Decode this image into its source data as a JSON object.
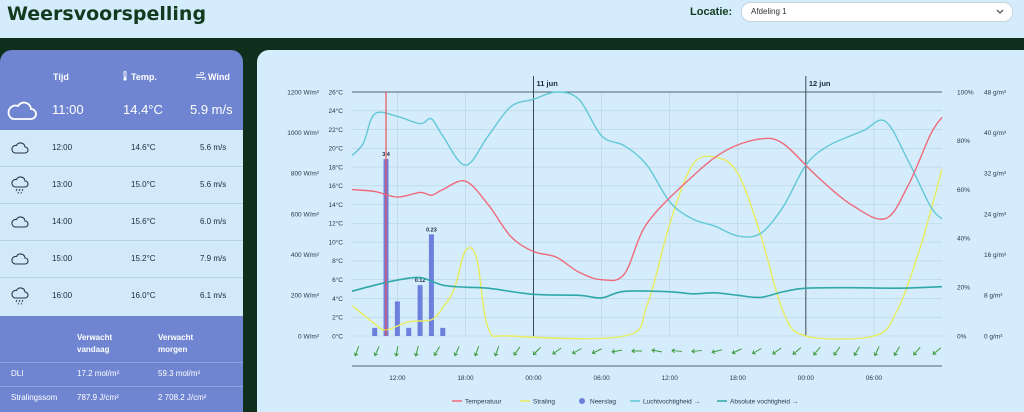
{
  "header": {
    "title": "Weersvoorspelling",
    "location_label": "Locatie:",
    "location_value": "Afdeling 1"
  },
  "current": {
    "col_time": "Tijd",
    "col_temp": "Temp.",
    "col_wind": "Wind",
    "time": "11:00",
    "temp": "14.4°C",
    "wind": "5.9 m/s",
    "icon": "cloud-icon"
  },
  "forecast": [
    {
      "time": "12:00",
      "temp": "14.6°C",
      "wind": "5.6 m/s",
      "icon": "cloud-icon"
    },
    {
      "time": "13:00",
      "temp": "15.0°C",
      "wind": "5.6 m/s",
      "icon": "cloud-drizzle-icon"
    },
    {
      "time": "14:00",
      "temp": "15.6°C",
      "wind": "6.0 m/s",
      "icon": "cloud-icon"
    },
    {
      "time": "15:00",
      "temp": "15.2°C",
      "wind": "7.9 m/s",
      "icon": "cloud-icon"
    },
    {
      "time": "16:00",
      "temp": "16.0°C",
      "wind": "6.1 m/s",
      "icon": "cloud-drizzle-icon"
    }
  ],
  "summary": {
    "col_today": "Verwacht vandaag",
    "col_tomorrow": "Verwacht morgen",
    "rows": [
      {
        "label": "DLI",
        "today": "17.2 mol/m²",
        "tomorrow": "59.3 mol/m²"
      },
      {
        "label": "Stralingssom",
        "today": "787.9 J/cm²",
        "tomorrow": "2 708.2 J/cm²"
      }
    ]
  },
  "chart_data": {
    "type": "line",
    "day_labels": [
      "11 jun",
      "12 jun"
    ],
    "x_ticks": [
      "12:00",
      "18:00",
      "00:00",
      "06:00",
      "12:00",
      "18:00",
      "00:00",
      "06:00"
    ],
    "axes": {
      "radiation": {
        "ticks": [
          "0 W/m²",
          "200 W/m²",
          "400 W/m²",
          "600 W/m²",
          "800 W/m²",
          "1000 W/m²",
          "1200 W/m²"
        ],
        "range": [
          0,
          1200
        ]
      },
      "temperature": {
        "ticks": [
          "0°C",
          "2°C",
          "4°C",
          "6°C",
          "8°C",
          "10°C",
          "12°C",
          "14°C",
          "16°C",
          "18°C",
          "20°C",
          "22°C",
          "24°C",
          "26°C"
        ],
        "range": [
          0,
          26
        ]
      },
      "humidity": {
        "ticks": [
          "0%",
          "20%",
          "40%",
          "60%",
          "80%",
          "100%"
        ],
        "range": [
          0,
          100
        ]
      },
      "absolute_humidity": {
        "ticks": [
          "0 g/m³",
          "8 g/m³",
          "16 g/m³",
          "24 g/m³",
          "32 g/m³",
          "40 g/m³",
          "48 g/m³"
        ],
        "range": [
          0,
          48
        ]
      }
    },
    "x_range_hours": [
      0,
      52
    ],
    "current_hour": 3,
    "series": [
      {
        "name": "Temperatuur",
        "color": "#ef6a7a",
        "axis": "temperature",
        "points": [
          [
            0,
            15.6
          ],
          [
            2,
            15.4
          ],
          [
            4,
            14.8
          ],
          [
            6,
            15.3
          ],
          [
            7,
            15.0
          ],
          [
            8,
            15.6
          ],
          [
            10,
            16.5
          ],
          [
            12,
            14.0
          ],
          [
            14,
            10.6
          ],
          [
            16,
            9.0
          ],
          [
            18,
            8.4
          ],
          [
            20,
            6.8
          ],
          [
            22,
            6.0
          ],
          [
            24,
            6.6
          ],
          [
            26,
            12.0
          ],
          [
            30,
            17.0
          ],
          [
            33,
            19.8
          ],
          [
            36,
            21.0
          ],
          [
            38,
            20.5
          ],
          [
            41,
            17.0
          ],
          [
            44,
            14.0
          ],
          [
            47,
            12.5
          ],
          [
            49,
            16.0
          ],
          [
            51,
            21.5
          ],
          [
            52,
            23.3
          ]
        ]
      },
      {
        "name": "Straling",
        "color": "#e9ec5d",
        "axis": "radiation",
        "points": [
          [
            0,
            150
          ],
          [
            2,
            60
          ],
          [
            3,
            30
          ],
          [
            5,
            70
          ],
          [
            7,
            80
          ],
          [
            8,
            140
          ],
          [
            9,
            230
          ],
          [
            10,
            420
          ],
          [
            11,
            380
          ],
          [
            12,
            40
          ],
          [
            14,
            0
          ],
          [
            24,
            0
          ],
          [
            26,
            150
          ],
          [
            28,
            550
          ],
          [
            30,
            840
          ],
          [
            32,
            880
          ],
          [
            34,
            800
          ],
          [
            36,
            500
          ],
          [
            38,
            120
          ],
          [
            40,
            0
          ],
          [
            46,
            0
          ],
          [
            48,
            120
          ],
          [
            50,
            420
          ],
          [
            52,
            820
          ]
        ]
      },
      {
        "name": "Neerslag",
        "color": "#6d80dd",
        "axis": "radiation",
        "type": "bar",
        "points": [
          [
            2,
            40
          ],
          [
            3,
            870
          ],
          [
            4,
            170
          ],
          [
            5,
            40
          ],
          [
            6,
            250
          ],
          [
            7,
            500
          ],
          [
            8,
            40
          ]
        ]
      },
      {
        "name": "Luchtvochtigheid",
        "color": "#62c8d6",
        "axis": "humidity",
        "points": [
          [
            0,
            74
          ],
          [
            1,
            79
          ],
          [
            2,
            91
          ],
          [
            4,
            90
          ],
          [
            6,
            87
          ],
          [
            7,
            89
          ],
          [
            8,
            82
          ],
          [
            10,
            70
          ],
          [
            12,
            82
          ],
          [
            14,
            94
          ],
          [
            16,
            97
          ],
          [
            18,
            100
          ],
          [
            20,
            97
          ],
          [
            22,
            82
          ],
          [
            24,
            78
          ],
          [
            26,
            70
          ],
          [
            28,
            55
          ],
          [
            30,
            48
          ],
          [
            32,
            45
          ],
          [
            34,
            41
          ],
          [
            36,
            42
          ],
          [
            38,
            53
          ],
          [
            40,
            70
          ],
          [
            42,
            78
          ],
          [
            45,
            84
          ],
          [
            47,
            88
          ],
          [
            49,
            72
          ],
          [
            51,
            53
          ],
          [
            52,
            48
          ]
        ]
      },
      {
        "name": "Absolute vochtigheid",
        "color": "#2fa9a7",
        "axis": "absolute_humidity",
        "points": [
          [
            0,
            8.8
          ],
          [
            2,
            10.0
          ],
          [
            4,
            11.0
          ],
          [
            6,
            11.5
          ],
          [
            8,
            10.0
          ],
          [
            10,
            9.6
          ],
          [
            12,
            9.4
          ],
          [
            16,
            8.2
          ],
          [
            20,
            8.0
          ],
          [
            22,
            7.5
          ],
          [
            24,
            8.8
          ],
          [
            28,
            8.7
          ],
          [
            30,
            8.3
          ],
          [
            32,
            8.5
          ],
          [
            34,
            8.0
          ],
          [
            36,
            7.6
          ],
          [
            38,
            8.7
          ],
          [
            40,
            9.4
          ],
          [
            44,
            9.5
          ],
          [
            48,
            9.4
          ],
          [
            52,
            9.7
          ]
        ]
      }
    ],
    "bar_labels": [
      {
        "hour": 3,
        "text": "3.4"
      },
      {
        "hour": 6,
        "text": "0.12"
      },
      {
        "hour": 7,
        "text": "0.23"
      }
    ],
    "legend": [
      "Temperatuur",
      "Straling",
      "Neerslag",
      "Luchtvochtigheid →",
      "Absolute vochtigheid →"
    ],
    "wind_dirs": [
      200,
      205,
      190,
      195,
      210,
      205,
      200,
      200,
      215,
      225,
      235,
      240,
      245,
      260,
      270,
      280,
      275,
      265,
      255,
      245,
      240,
      235,
      230,
      220,
      215,
      210,
      205,
      210,
      220,
      230
    ]
  }
}
